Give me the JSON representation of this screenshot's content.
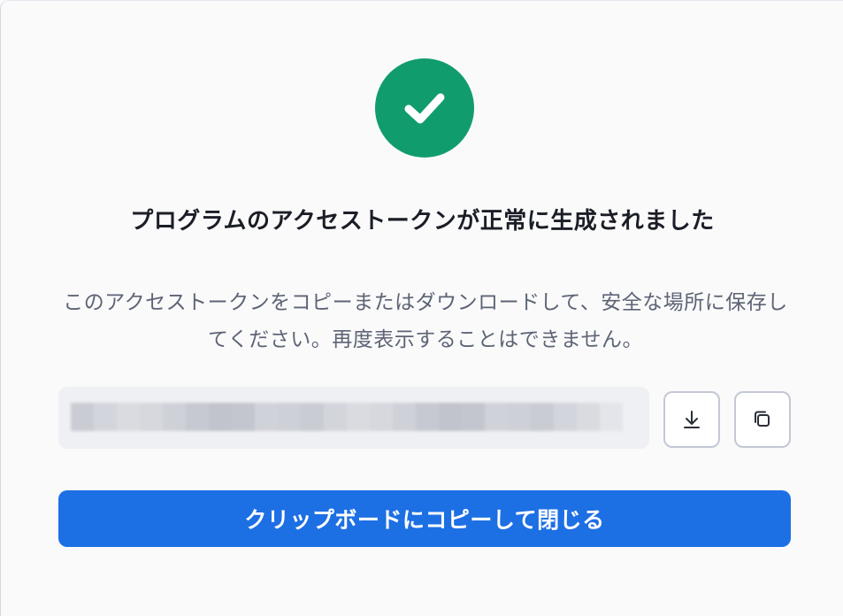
{
  "dialog": {
    "status_icon": "check-circle-icon",
    "title": "プログラムのアクセストークンが正常に生成されました",
    "description": "このアクセストークンをコピーまたはダウンロードして、安全な場所に保存してください。再度表示することはできません。",
    "token": {
      "value": "",
      "masked": true
    },
    "actions": {
      "download_icon": "download-icon",
      "copy_icon": "copy-icon",
      "primary_label": "クリップボードにコピーして閉じる"
    }
  },
  "colors": {
    "success": "#119c6e",
    "primary": "#1d6fe4",
    "title_text": "#1b1e26",
    "body_text": "#5d6474",
    "field_bg": "#eff0f3",
    "button_border": "#c3c8d4"
  }
}
